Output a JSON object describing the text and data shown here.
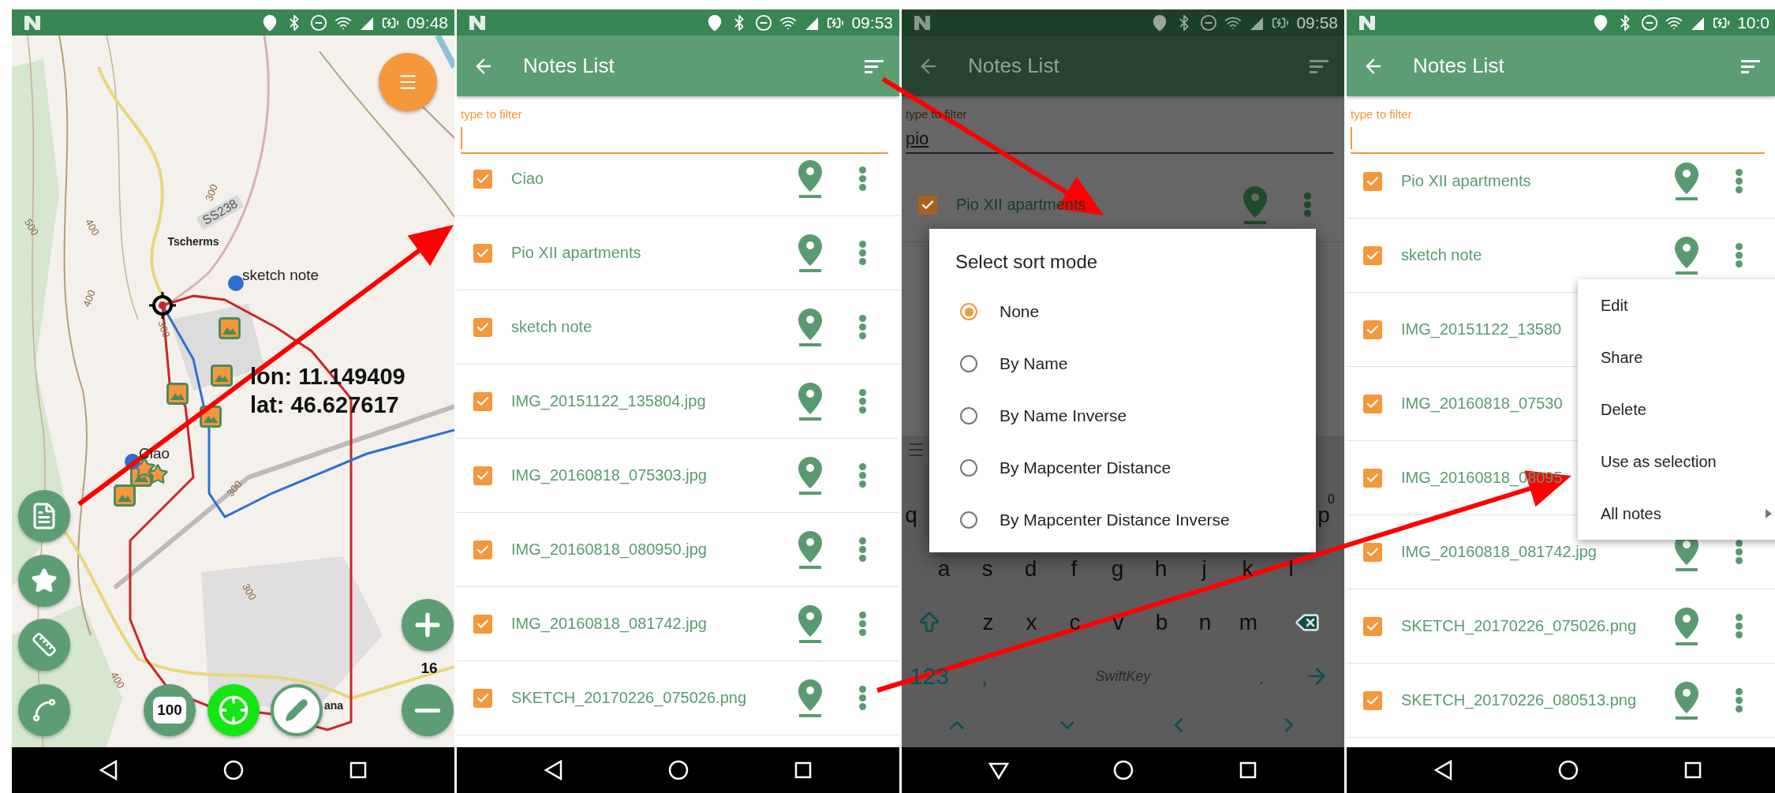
{
  "map_screen": {
    "status_time": "09:48",
    "labels": [
      {
        "text": "SS238",
        "kind": "road"
      },
      {
        "text": "Tscherms",
        "kind": "place"
      },
      {
        "text": "300",
        "kind": "contour"
      },
      {
        "text": "300",
        "kind": "contour"
      },
      {
        "text": "300",
        "kind": "contour"
      },
      {
        "text": "300",
        "kind": "contour"
      },
      {
        "text": "400",
        "kind": "contour"
      },
      {
        "text": "400",
        "kind": "contour"
      },
      {
        "text": "400",
        "kind": "contour"
      },
      {
        "text": "500",
        "kind": "contour"
      },
      {
        "text": "ana",
        "kind": "place"
      }
    ],
    "notes": [
      {
        "label": "sketch note"
      },
      {
        "label": "Ciao"
      }
    ],
    "coordinates": [
      "lon: 11.149409",
      "lat: 46.627617"
    ],
    "zoom_level": "16",
    "battery_button": "100"
  },
  "notes_screen": {
    "status_time": "09:53",
    "title": "Notes List",
    "filter_label": "type to filter",
    "rows": [
      {
        "name": "Ciao",
        "checked": true
      },
      {
        "name": "Pio XII apartments",
        "checked": true
      },
      {
        "name": "sketch note",
        "checked": true
      },
      {
        "name": "IMG_20151122_135804.jpg",
        "checked": true
      },
      {
        "name": "IMG_20160818_075303.jpg",
        "checked": true
      },
      {
        "name": "IMG_20160818_080950.jpg",
        "checked": true
      },
      {
        "name": "IMG_20160818_081742.jpg",
        "checked": true
      },
      {
        "name": "SKETCH_20170226_075026.png",
        "checked": true
      }
    ]
  },
  "sort_screen": {
    "status_time": "09:58",
    "title": "Notes List",
    "filter_label": "type to filter",
    "filter_value": "pio",
    "rows": [
      {
        "name": "Pio XII apartments",
        "checked": true
      }
    ],
    "dialog": {
      "title": "Select sort mode",
      "options": [
        {
          "label": "None",
          "selected": true
        },
        {
          "label": "By Name",
          "selected": false
        },
        {
          "label": "By Name Inverse",
          "selected": false
        },
        {
          "label": "By Mapcenter Distance",
          "selected": false
        },
        {
          "label": "By Mapcenter Distance Inverse",
          "selected": false
        }
      ]
    },
    "keyboard": {
      "top_row_keys": [
        "q",
        "p"
      ],
      "home_row_keys": [
        "a",
        "s",
        "d",
        "f",
        "g",
        "h",
        "j",
        "k",
        "l"
      ],
      "bottom_row_keys": [
        "z",
        "x",
        "c",
        "v",
        "b",
        "n",
        "m"
      ],
      "hint": "0",
      "number_key": "123",
      "comma_key": ",",
      "brand": "SwiftKey",
      "period_key": "."
    }
  },
  "menu_screen": {
    "status_time": "10:0",
    "title": "Notes List",
    "filter_label": "type to filter",
    "rows": [
      {
        "name": "Pio XII apartments",
        "checked": true
      },
      {
        "name": "sketch note",
        "checked": true
      },
      {
        "name": "IMG_20151122_13580",
        "checked": true
      },
      {
        "name": "IMG_20160818_07530",
        "checked": true
      },
      {
        "name": "IMG_20160818_08095",
        "checked": true
      },
      {
        "name": "IMG_20160818_081742.jpg",
        "checked": true
      },
      {
        "name": "SKETCH_20170226_075026.png",
        "checked": true
      },
      {
        "name": "SKETCH_20170226_080513.png",
        "checked": true
      }
    ],
    "menu": {
      "items": [
        {
          "label": "Edit",
          "submenu": false
        },
        {
          "label": "Share",
          "submenu": false
        },
        {
          "label": "Delete",
          "submenu": false
        },
        {
          "label": "Use as selection",
          "submenu": false
        },
        {
          "label": "All notes",
          "submenu": true
        }
      ]
    }
  }
}
